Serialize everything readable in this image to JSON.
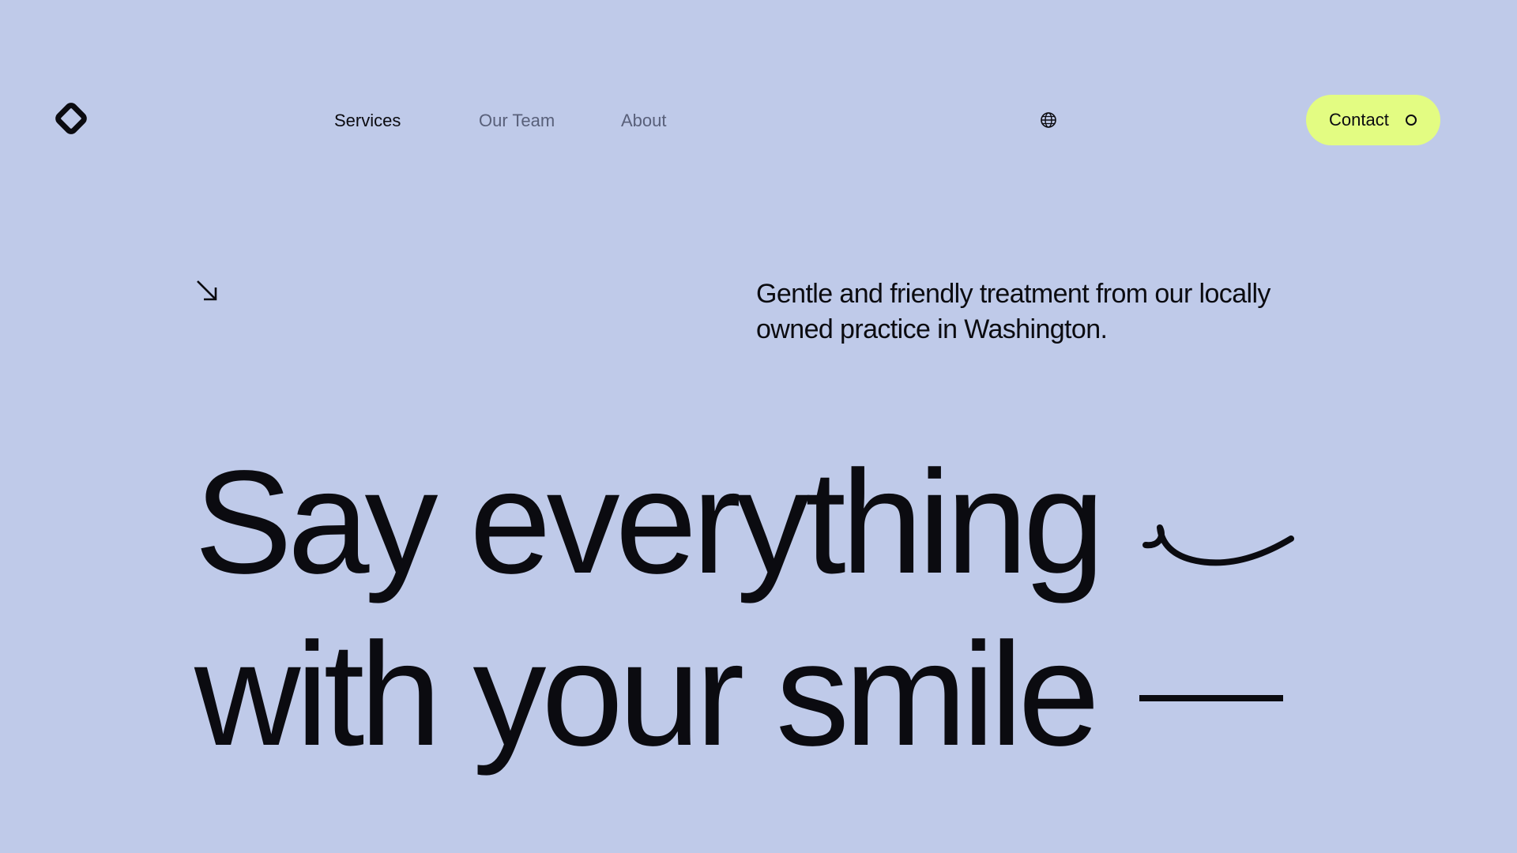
{
  "brand": {
    "logo_icon": "diamond-logo-icon"
  },
  "nav": {
    "items": [
      {
        "label": "Services",
        "state": "active"
      },
      {
        "label": "Our Team",
        "state": "inactive"
      },
      {
        "label": "About",
        "state": "inactive"
      }
    ],
    "language_icon": "globe-icon"
  },
  "contact": {
    "label": "Contact",
    "icon": "circle-icon"
  },
  "intro": {
    "arrow_icon": "arrow-down-right-icon",
    "tagline": "Gentle and friendly treatment from our locally owned practice in Washington."
  },
  "hero": {
    "line1": "Say everything",
    "line2": "with your smile",
    "line1_mark_icon": "smile-curve-icon",
    "line2_mark_icon": "dash-line-icon"
  },
  "colors": {
    "background": "#bfcae9",
    "accent": "#e3fc82",
    "text": "#0b0b10",
    "muted_text": "#59607a"
  }
}
